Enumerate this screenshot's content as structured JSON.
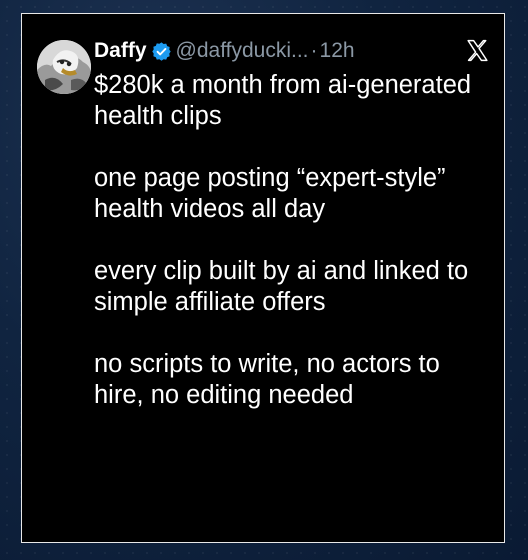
{
  "tweet": {
    "author_name": "Daffy",
    "handle": "@daffyducki...",
    "separator": "·",
    "time": "12h",
    "paragraphs": [
      "$280k a month from ai-generated health clips",
      "one page posting “expert-style” health videos all day",
      "every clip built by ai and linked to simple affiliate offers",
      "no scripts to write, no actors to hire, no editing needed"
    ]
  },
  "icons": {
    "verified": "verified-badge-icon",
    "platform": "x-logo-icon"
  },
  "colors": {
    "card_background": "#000000",
    "card_border": "#e8e8e8",
    "text_primary": "#ffffff",
    "text_secondary": "#8b98a5",
    "verified_blue": "#1d9bf0",
    "page_background": "#102440"
  }
}
